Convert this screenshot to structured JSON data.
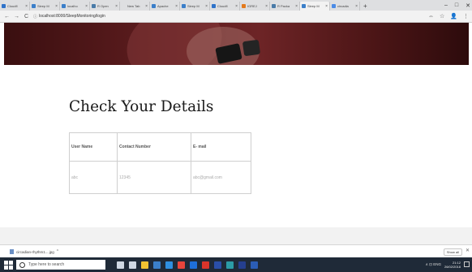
{
  "browser": {
    "tabs": [
      {
        "label": "Cloudfl",
        "color": "#2f73c9",
        "active": false
      },
      {
        "label": "Sleep M",
        "color": "#3b7fc9",
        "active": false
      },
      {
        "label": "localho",
        "color": "#3b7fc9",
        "active": false
      },
      {
        "label": "R Open",
        "color": "#4a7ba8",
        "active": false
      },
      {
        "label": "New Tab",
        "color": "#dedfe1",
        "active": false
      },
      {
        "label": "Apache",
        "color": "#3b7fc9",
        "active": false
      },
      {
        "label": "Sleep M",
        "color": "#3b7fc9",
        "active": false
      },
      {
        "label": "Cloudfl",
        "color": "#2f73c9",
        "active": false
      },
      {
        "label": "IGREJ",
        "color": "#e37a1d",
        "active": false
      },
      {
        "label": "R Packa",
        "color": "#4a7ba8",
        "active": false
      },
      {
        "label": "Sleep M",
        "color": "#3b7fc9",
        "active": true
      },
      {
        "label": "circadia",
        "color": "#4b8be6",
        "active": false
      }
    ],
    "new_tab_glyph": "+",
    "window_controls": {
      "minimize": "–",
      "maximize": "□",
      "close": "✕"
    },
    "nav": {
      "back": "←",
      "forward": "→",
      "reload": "C"
    },
    "address": "localhost:8000/SleepMonitoring/login",
    "address_info_glyph": "ⓘ",
    "toolbar_right": {
      "extension": "⇔",
      "star": "☆",
      "account": "👤",
      "menu": "⋮"
    }
  },
  "page": {
    "title": "Check Your Details",
    "table": {
      "headers": [
        "User Name",
        "Contact Number",
        "E- mail"
      ],
      "rows": [
        [
          "abc",
          "12345",
          "abc@gmail.com"
        ]
      ]
    }
  },
  "downloads": {
    "file_name": "circadian-rhythm1....jpg",
    "caret": "^",
    "show_all": "Show all",
    "close": "✕"
  },
  "taskbar": {
    "search_placeholder": "Type here to search",
    "app_icons": [
      {
        "name": "mic-icon",
        "color": "#cfd8e3"
      },
      {
        "name": "task-view-icon",
        "color": "#cfd8e3"
      },
      {
        "name": "file-explorer-icon",
        "color": "#f1c232"
      },
      {
        "name": "store-icon",
        "color": "#3b7fc9"
      },
      {
        "name": "edge-icon",
        "color": "#2f8fe0"
      },
      {
        "name": "chrome-icon",
        "color": "#e8453c"
      },
      {
        "name": "app-icon-blue",
        "color": "#1e6fd9"
      },
      {
        "name": "app-icon-red",
        "color": "#d9342b"
      },
      {
        "name": "app-icon-darkblue",
        "color": "#2a4fa8"
      },
      {
        "name": "app-icon-teal",
        "color": "#2c9ca6"
      },
      {
        "name": "app-icon-navy",
        "color": "#253f8f"
      },
      {
        "name": "word-icon",
        "color": "#2b5db5"
      }
    ],
    "tray_text": "∧  ⊡  ENG",
    "time": "21:12",
    "date": "26/02/2018"
  }
}
